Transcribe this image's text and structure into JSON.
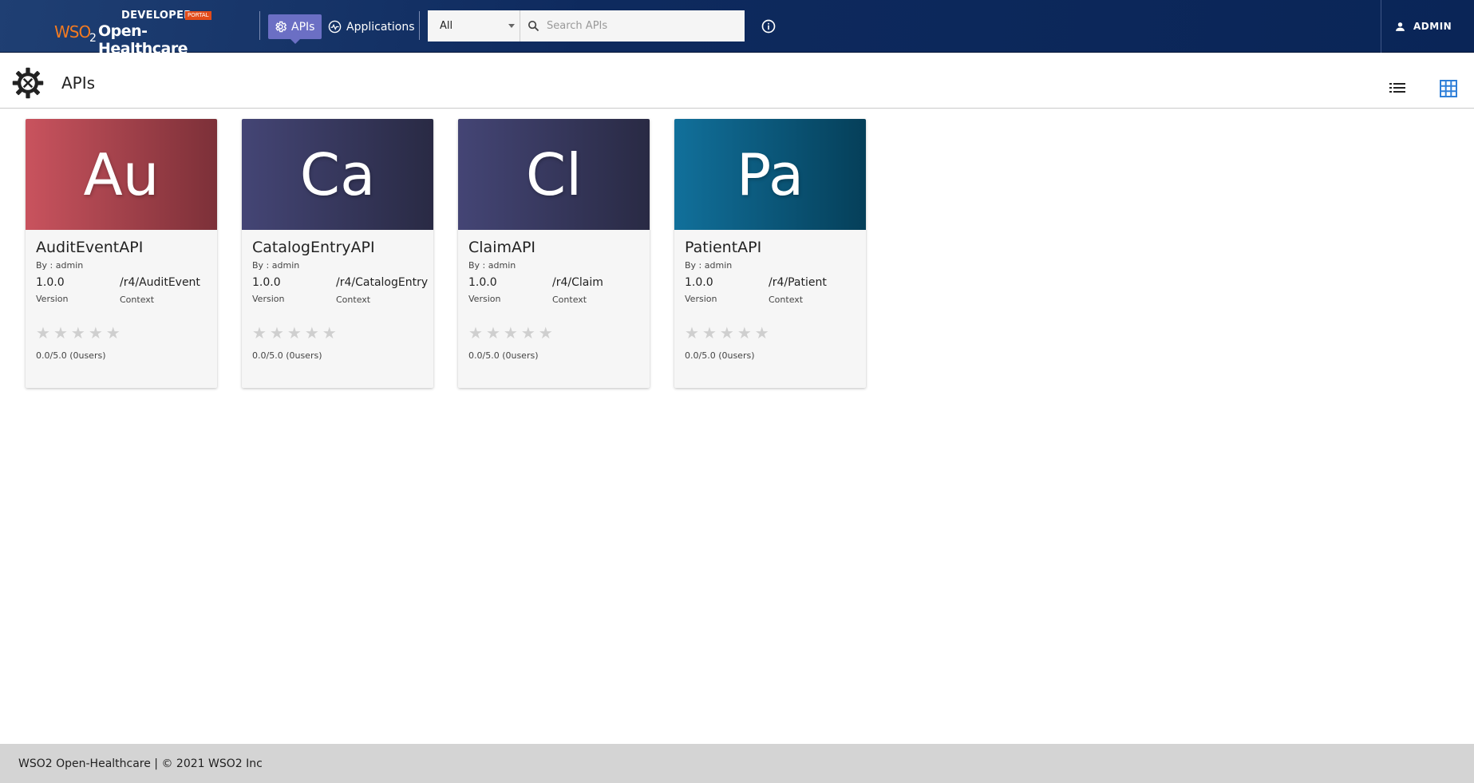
{
  "header": {
    "logo": {
      "developer": "DEVELOPER",
      "portal": "PORTAL",
      "wso": "WSO",
      "two": "2",
      "product": "Open-Healthcare"
    },
    "nav": [
      {
        "label": "APIs",
        "icon": "gear-icon",
        "active": true
      },
      {
        "label": "Applications",
        "icon": "activity-icon",
        "active": false
      }
    ],
    "search": {
      "filter_value": "All",
      "placeholder": "Search APIs"
    },
    "user": {
      "label": "ADMIN"
    }
  },
  "page": {
    "title": "APIs"
  },
  "cards": [
    {
      "thumb_text": "Au",
      "name": "AuditEventAPI",
      "by": "By : admin",
      "version": "1.0.0",
      "version_label": "Version",
      "context": "/r4/AuditEvent",
      "context_label": "Context",
      "rating": "0.0/5.0 (0users)",
      "colors": [
        "#c9535e",
        "#7c3038"
      ]
    },
    {
      "thumb_text": "Ca",
      "name": "CatalogEntryAPI",
      "by": "By : admin",
      "version": "1.0.0",
      "version_label": "Version",
      "context": "/r4/CatalogEntry",
      "context_label": "Context",
      "rating": "0.0/5.0 (0users)",
      "colors": [
        "#444575",
        "#292a44"
      ]
    },
    {
      "thumb_text": "Cl",
      "name": "ClaimAPI",
      "by": "By : admin",
      "version": "1.0.0",
      "version_label": "Version",
      "context": "/r4/Claim",
      "context_label": "Context",
      "rating": "0.0/5.0 (0users)",
      "colors": [
        "#444575",
        "#292a44"
      ]
    },
    {
      "thumb_text": "Pa",
      "name": "PatientAPI",
      "by": "By : admin",
      "version": "1.0.0",
      "version_label": "Version",
      "context": "/r4/Patient",
      "context_label": "Context",
      "rating": "0.0/5.0 (0users)",
      "colors": [
        "#11709b",
        "#053f59"
      ]
    }
  ],
  "footer": {
    "text": "WSO2 Open-Healthcare | © 2021 WSO2 Inc"
  }
}
